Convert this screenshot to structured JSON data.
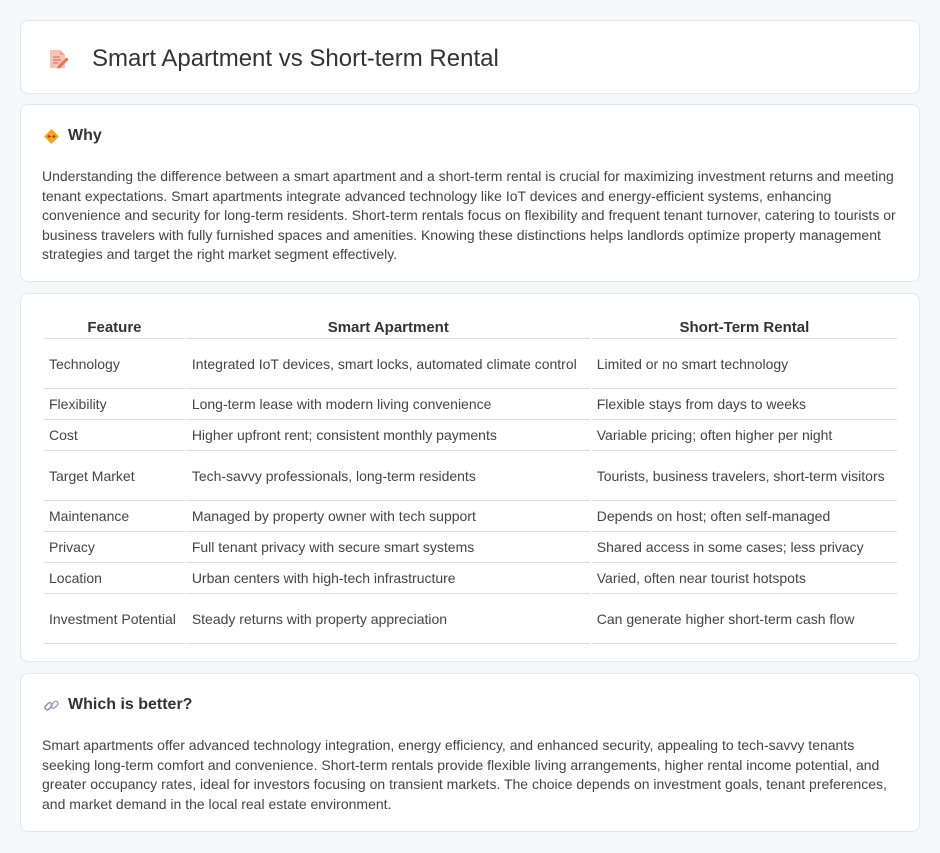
{
  "header": {
    "title": "Smart Apartment vs Short-term Rental",
    "icon": "edit-document-icon"
  },
  "why": {
    "heading": "Why",
    "icon": "diamond-arrows-icon",
    "text": "Understanding the difference between a smart apartment and a short-term rental is crucial for maximizing investment returns and meeting tenant expectations. Smart apartments integrate advanced technology like IoT devices and energy-efficient systems, enhancing convenience and security for long-term residents. Short-term rentals focus on flexibility and frequent tenant turnover, catering to tourists or business travelers with fully furnished spaces and amenities. Knowing these distinctions helps landlords optimize property management strategies and target the right market segment effectively."
  },
  "table": {
    "headers": [
      "Feature",
      "Smart Apartment",
      "Short-Term Rental"
    ],
    "rows": [
      [
        "Technology",
        "Integrated IoT devices, smart locks, automated climate control",
        "Limited or no smart technology"
      ],
      [
        "Flexibility",
        "Long-term lease with modern living convenience",
        "Flexible stays from days to weeks"
      ],
      [
        "Cost",
        "Higher upfront rent; consistent monthly payments",
        "Variable pricing; often higher per night"
      ],
      [
        "Target Market",
        "Tech-savvy professionals, long-term residents",
        "Tourists, business travelers, short-term visitors"
      ],
      [
        "Maintenance",
        "Managed by property owner with tech support",
        "Depends on host; often self-managed"
      ],
      [
        "Privacy",
        "Full tenant privacy with secure smart systems",
        "Shared access in some cases; less privacy"
      ],
      [
        "Location",
        "Urban centers with high-tech infrastructure",
        "Varied, often near tourist hotspots"
      ],
      [
        "Investment Potential",
        "Steady returns with property appreciation",
        "Can generate higher short-term cash flow"
      ]
    ]
  },
  "better": {
    "heading": "Which is better?",
    "icon": "link-icon",
    "text": "Smart apartments offer advanced technology integration, energy efficiency, and enhanced security, appealing to tech-savvy tenants seeking long-term comfort and convenience. Short-term rentals provide flexible living arrangements, higher rental income potential, and greater occupancy rates, ideal for investors focusing on transient markets. The choice depends on investment goals, tenant preferences, and market demand in the local real estate environment."
  }
}
